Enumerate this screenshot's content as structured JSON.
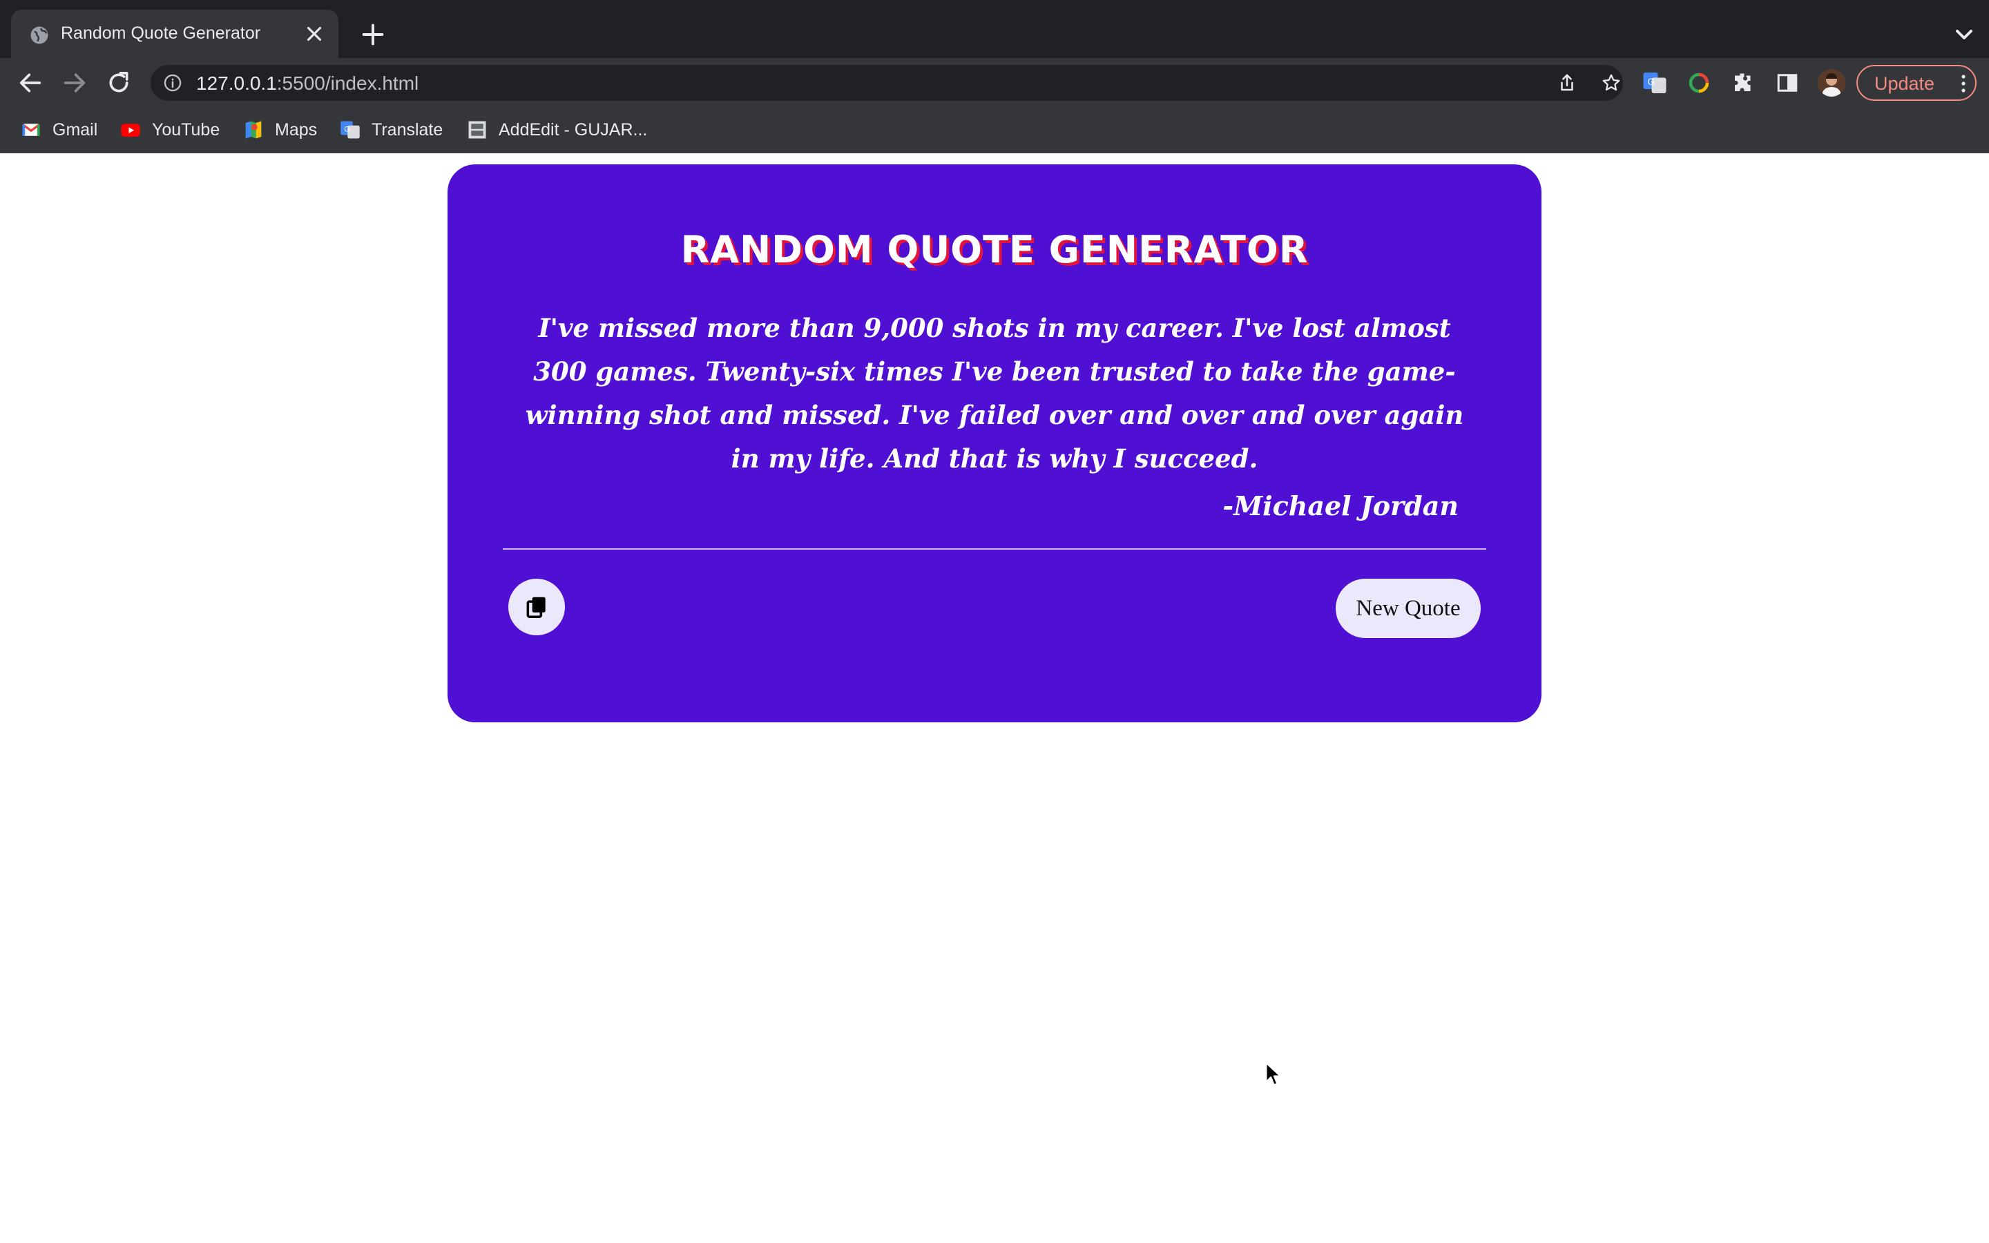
{
  "browser": {
    "tab": {
      "title": "Random Quote Generator"
    },
    "address_bar": {
      "host": "127.0.0.1",
      "rest": ":5500/index.html"
    },
    "update_label": "Update",
    "bookmarks": [
      {
        "label": "Gmail",
        "icon": "gmail-icon"
      },
      {
        "label": "YouTube",
        "icon": "youtube-icon"
      },
      {
        "label": "Maps",
        "icon": "maps-icon"
      },
      {
        "label": "Translate",
        "icon": "translate-icon"
      },
      {
        "label": "AddEdit - GUJAR...",
        "icon": "addedit-icon"
      }
    ]
  },
  "app": {
    "title": "RANDOM QUOTE GENERATOR",
    "quote": "I've missed more than 9,000 shots in my career. I've lost almost 300 games. Twenty-six times I've been trusted to take the game-winning shot and missed. I've failed over and over and over again in my life. And that is why I succeed.",
    "author": "-Michael Jordan",
    "copy_icon": "copy-icon",
    "new_quote_label": "New Quote"
  },
  "colors": {
    "card_background": "#4f10d4",
    "title_shadow": "#e0143c",
    "button_background": "#ece8fb",
    "update_accent": "#f28b82"
  }
}
